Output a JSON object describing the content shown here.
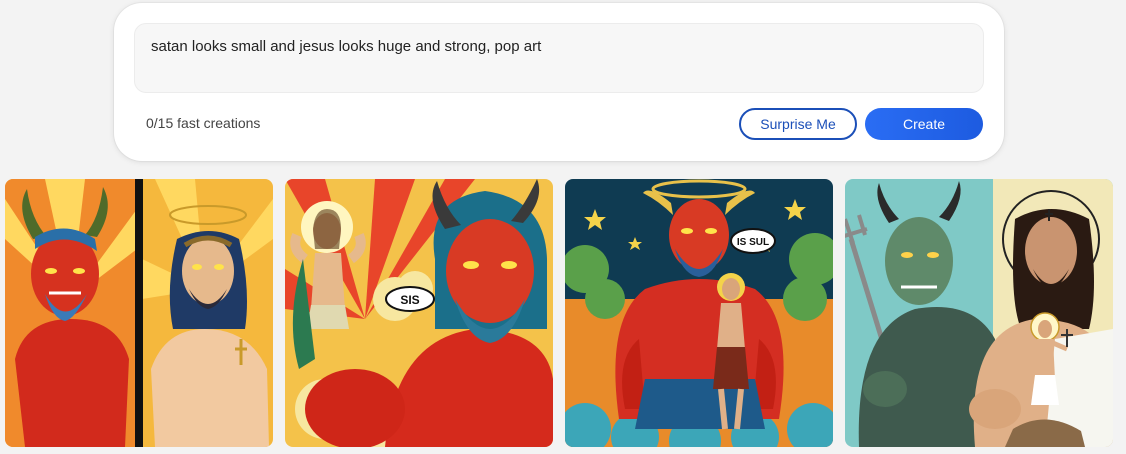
{
  "composer": {
    "prompt_text": "satan looks small and jesus looks huge and strong, pop art",
    "counter_text": "0/15 fast creations",
    "surprise_label": "Surprise Me",
    "create_label": "Create"
  },
  "gallery": {
    "images": [
      {
        "alt": "pop art devil and jesus side by side",
        "speech": ""
      },
      {
        "alt": "pop art small jesus flexing beside large red devil",
        "speech": "SIS"
      },
      {
        "alt": "pop art large red devil with small jesus in front",
        "speech": "IS SUL"
      },
      {
        "alt": "pop art green devil with trident and muscular jesus",
        "speech": ""
      }
    ]
  },
  "colors": {
    "accent": "#1d5be0",
    "accent_text": "#1b4fb8",
    "background": "#f3f3f3"
  }
}
